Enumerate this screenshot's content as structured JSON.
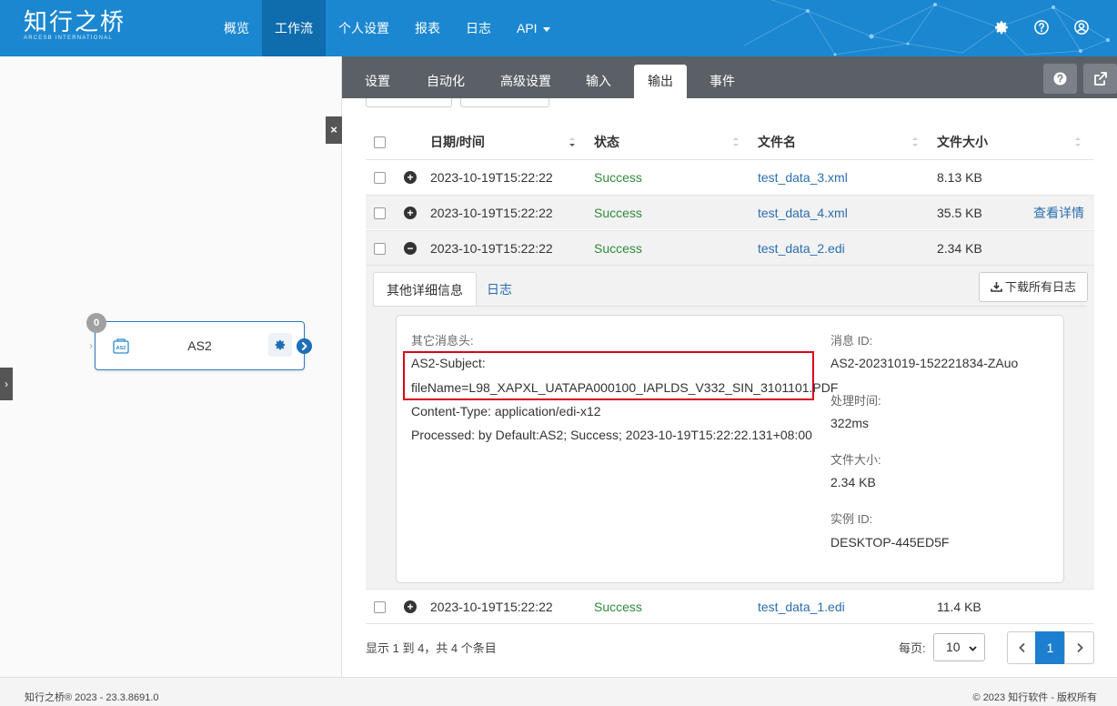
{
  "brand": {
    "name_cn": "知行之桥",
    "name_en": "ARCESB INTERNATIONAL"
  },
  "nav": {
    "items": [
      {
        "label": "概览"
      },
      {
        "label": "工作流"
      },
      {
        "label": "个人设置"
      },
      {
        "label": "报表"
      },
      {
        "label": "日志"
      },
      {
        "label": "API"
      }
    ],
    "active": "工作流",
    "icons": [
      "gear-icon",
      "help-circle-icon",
      "user-circle-icon"
    ]
  },
  "canvas": {
    "close_label": "×",
    "node": {
      "label": "AS2",
      "badge": "0",
      "icon": "as2-connector-icon"
    }
  },
  "tabs": {
    "items": [
      {
        "label": "设置"
      },
      {
        "label": "自动化"
      },
      {
        "label": "高级设置"
      },
      {
        "label": "输入"
      },
      {
        "label": "输出"
      },
      {
        "label": "事件"
      }
    ],
    "active": "输出",
    "buttons": [
      "help-icon",
      "external-link-icon"
    ]
  },
  "table": {
    "columns": {
      "datetime": "日期/时间",
      "status": "状态",
      "filename": "文件名",
      "filesize": "文件大小"
    },
    "rows": [
      {
        "datetime": "2023-10-19T15:22:22",
        "status": "Success",
        "filename": "test_data_3.xml",
        "filesize": "8.13 KB",
        "action": ""
      },
      {
        "datetime": "2023-10-19T15:22:22",
        "status": "Success",
        "filename": "test_data_4.xml",
        "filesize": "35.5 KB",
        "action": "查看详情"
      },
      {
        "datetime": "2023-10-19T15:22:22",
        "status": "Success",
        "filename": "test_data_2.edi",
        "filesize": "2.34 KB",
        "action": ""
      },
      {
        "datetime": "2023-10-19T15:22:22",
        "status": "Success",
        "filename": "test_data_1.edi",
        "filesize": "11.4 KB",
        "action": ""
      }
    ]
  },
  "detail": {
    "tabs": {
      "info": "其他详细信息",
      "log": "日志"
    },
    "download_label": "下载所有日志",
    "headers_label": "其它消息头:",
    "headers": [
      "AS2-Subject:",
      "fileName=L98_XAPXL_UATAPA000100_IAPLDS_V332_SIN_3101101.PDF",
      "Content-Type: application/edi-x12",
      "Processed: by Default:AS2; Success; 2023-10-19T15:22:22.131+08:00"
    ],
    "fields": [
      {
        "label": "消息 ID:",
        "value": "AS2-20231019-152221834-ZAuo"
      },
      {
        "label": "处理时间:",
        "value": "322ms"
      },
      {
        "label": "文件大小:",
        "value": "2.34 KB"
      },
      {
        "label": "实例 ID:",
        "value": "DESKTOP-445ED5F"
      }
    ]
  },
  "pager": {
    "info": "显示 1 到 4，共 4 个条目",
    "per_page_label": "每页:",
    "per_page_value": "10",
    "current_page": "1"
  },
  "footer": {
    "left": "知行之桥® 2023 - 23.3.8691.0",
    "right": "© 2023 知行软件 - 版权所有"
  },
  "colors": {
    "nav": "#1b87d0",
    "nav_active": "#0f6cad",
    "tabbar": "#5b5f66",
    "success": "#2f8a3a",
    "link": "#2a6eb0",
    "highlight": "#d9001b"
  }
}
